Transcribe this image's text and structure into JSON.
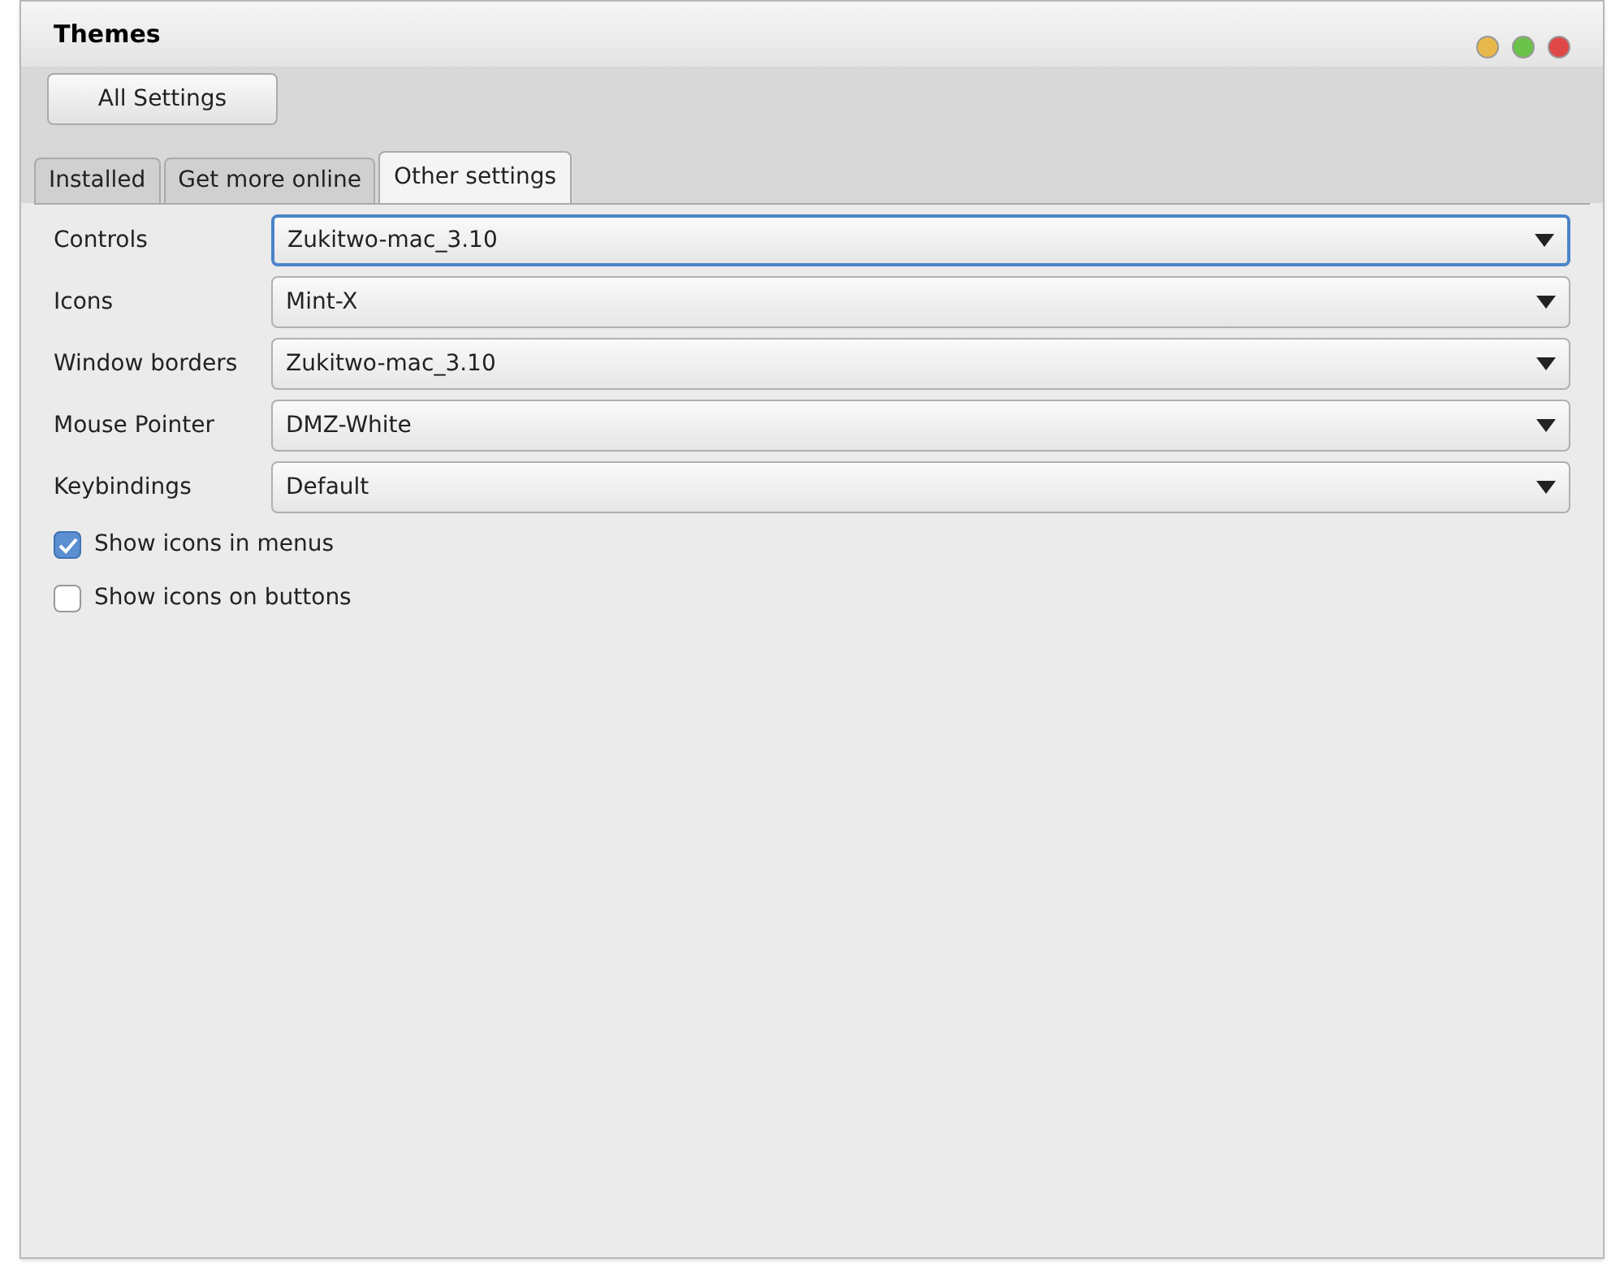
{
  "window": {
    "title": "Themes"
  },
  "toolbar": {
    "button": "All Settings"
  },
  "tabs": [
    {
      "label": "Installed",
      "selected": false
    },
    {
      "label": "Get more online",
      "selected": false
    },
    {
      "label": "Other settings",
      "selected": true
    }
  ],
  "settings": [
    {
      "label": "Controls",
      "value": "Zukitwo-mac_3.10",
      "focused": true
    },
    {
      "label": "Icons",
      "value": "Mint-X",
      "focused": false
    },
    {
      "label": "Window borders",
      "value": "Zukitwo-mac_3.10",
      "focused": false
    },
    {
      "label": "Mouse Pointer",
      "value": "DMZ-White",
      "focused": false
    },
    {
      "label": "Keybindings",
      "value": "Default",
      "focused": false
    }
  ],
  "options": [
    {
      "label": "Show icons in menus",
      "checked": true
    },
    {
      "label": "Show icons on buttons",
      "checked": false
    }
  ]
}
